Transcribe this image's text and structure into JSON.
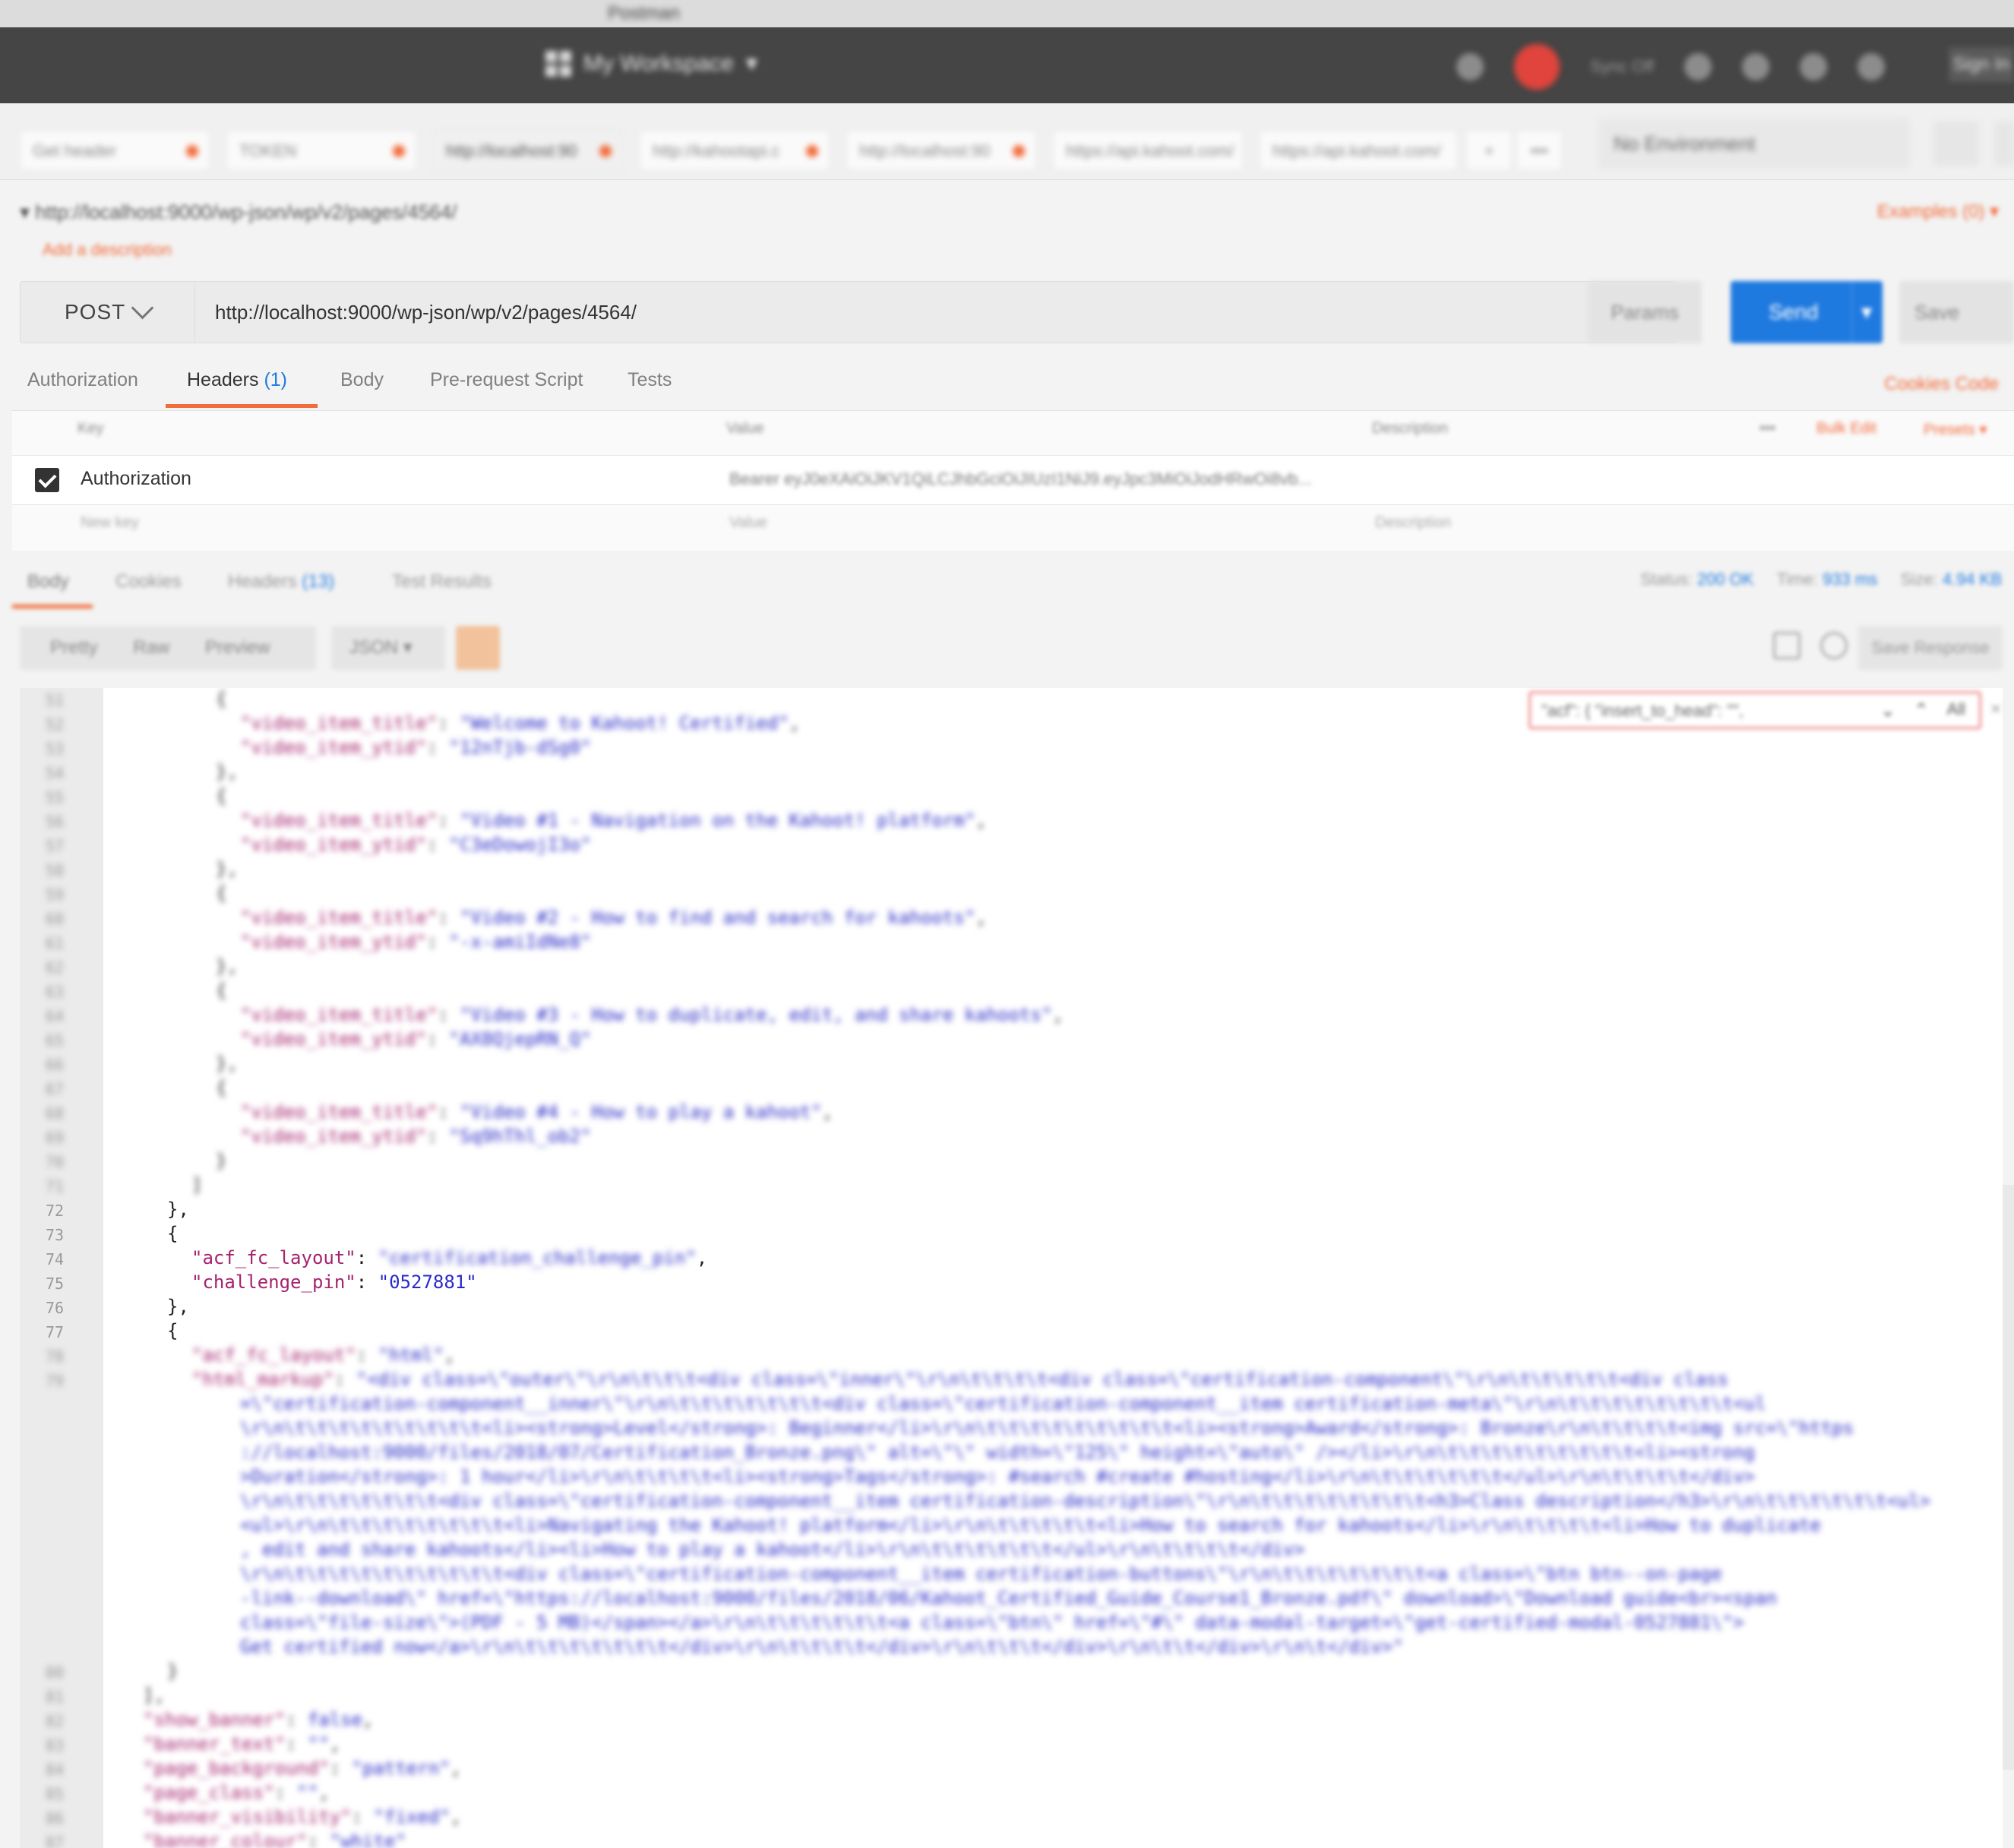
{
  "os_title": "Postman",
  "header": {
    "workspace": "My Workspace",
    "sync_status": "Sync Off",
    "sign_in": "Sign In"
  },
  "tabs": [
    {
      "label": "Get header"
    },
    {
      "label": "TOKEN"
    },
    {
      "label": "http://localhost:90"
    },
    {
      "label": "http://kahootapi.c"
    },
    {
      "label": "http://localhost:90"
    },
    {
      "label": "https://api.kahoot.com/"
    },
    {
      "label": "https://api.kahoot.com/"
    }
  ],
  "environment": "No Environment",
  "request": {
    "title_url": "http://localhost:9000/wp-json/wp/v2/pages/4564/",
    "add_description": "Add a description",
    "examples": "Examples (0)",
    "method": "POST",
    "url": "http://localhost:9000/wp-json/wp/v2/pages/4564/",
    "params": "Params",
    "send": "Send",
    "save": "Save"
  },
  "request_tabs": {
    "authorization": "Authorization",
    "headers": "Headers",
    "headers_count": "(1)",
    "body": "Body",
    "prerequest": "Pre-request Script",
    "tests": "Tests",
    "cookies": "Cookies  Code"
  },
  "headers_table": {
    "col_key": "Key",
    "col_value": "Value",
    "col_description": "Description",
    "bulk_edit": "Bulk Edit",
    "presets": "Presets",
    "row": {
      "key": "Authorization",
      "value": "Bearer eyJ0eXAiOiJKV1QiLCJhbGciOiJIUzI1NiJ9.eyJpc3MiOiJodHRwOi8vb..."
    },
    "placeholder_key": "New key",
    "placeholder_value": "Value",
    "placeholder_description": "Description"
  },
  "response": {
    "tabs": {
      "body": "Body",
      "cookies": "Cookies",
      "headers": "Headers",
      "headers_count": "(13)",
      "test_results": "Test Results"
    },
    "status_label": "Status:",
    "status": "200 OK",
    "time_label": "Time:",
    "time": "933 ms",
    "size_label": "Size:",
    "size": "4.94 KB",
    "view": {
      "pretty": "Pretty",
      "raw": "Raw",
      "preview": "Preview"
    },
    "format": "JSON",
    "save_response": "Save Response",
    "find_text": "\"acf\": {        \"insert_to_head\": \"\","
  },
  "code": {
    "line_numbers": [
      "51",
      "52",
      "53",
      "54",
      "55",
      "56",
      "57",
      "58",
      "59",
      "60",
      "61",
      "62",
      "63",
      "64",
      "65",
      "66",
      "67",
      "68",
      "69",
      "70",
      "71",
      "72",
      "73",
      "74",
      "75",
      "76",
      "77",
      "78",
      "79"
    ],
    "video_items": [
      {
        "title": "Welcome to Kahoot! Certified",
        "ytid": "12nTjb-dSg0"
      },
      {
        "title": "Video #1 - Navigation on the Kahoot! platform",
        "ytid": "C3eDowojI3o"
      },
      {
        "title": "Video #2 - How to find and search for kahoots",
        "ytid": "-x-amiIdNe8"
      },
      {
        "title": "Video #3 - How to duplicate, edit, and share kahoots",
        "ytid": "AX8QjepRN_Q"
      },
      {
        "title": "Video #4 - How to play a kahoot",
        "ytid": "Sq9hThl_ob2"
      }
    ],
    "video_title_key": "\"video_item_title\"",
    "video_ytid_key": "\"video_item_ytid\"",
    "acf_layout_key": "\"acf_fc_layout\"",
    "acf_layout_value": "\"certification_challenge_pin\"",
    "challenge_pin_key": "\"challenge_pin\"",
    "challenge_pin_value": "\"0527881\"",
    "html_layout_value": "\"html\"",
    "html_markup_key": "\"html_markup\"",
    "html_markup_lines": [
      "\"<div class=\\\"outer\\\"\\r\\n\\t\\t\\t<div class=\\\"inner\\\"\\r\\n\\t\\t\\t\\t<div class=\\\"certification-component\\\"\\r\\n\\t\\t\\t\\t\\t<div class",
      "=\\\"certification-component__inner\\\"\\r\\n\\t\\t\\t\\t\\t\\t\\t<div class=\\\"certification-component__item certification-meta\\\"\\r\\n\\t\\t\\t\\t\\t\\t\\t\\t<ul",
      "\\r\\n\\t\\t\\t\\t\\t\\t\\t\\t\\t<li><strong>Level</strong>: Beginner</li>\\r\\n\\t\\t\\t\\t\\t\\t\\t\\t\\t<li><strong>Award</strong>: Bronze\\r\\n\\t\\t\\t\\t<img src=\\\"https",
      "://localhost:9000/files/2018/07/Certification_Bronze.png\\\" alt=\\\"\\\" width=\\\"125\\\" height=\\\"auto\\\" /></li>\\r\\n\\t\\t\\t\\t\\t\\t\\t\\t\\t<li><strong",
      ">Duration</strong>: 1 hour</li>\\r\\n\\t\\t\\t\\t<li><strong>Tags</strong>: #search #create #hosting</li>\\r\\n\\t\\t\\t\\t\\t\\t</ul>\\r\\n\\t\\t\\t\\t</div>",
      "\\r\\n\\t\\t\\t\\t\\t\\t\\t<div class=\\\"certification-component__item certification-description\\\"\\r\\n\\t\\t\\t\\t\\t\\t\\t\\t<h3>Class description</h3>\\r\\n\\t\\t\\t\\t\\t\\t<ul>",
      "<ul>\\r\\n\\t\\t\\t\\t\\t\\t\\t\\t<li>Navigating the Kahoot! platform</li>\\r\\n\\t\\t\\t\\t\\t<li>How to search for kahoots</li>\\r\\n\\t\\t\\t\\t<li>How to duplicate",
      ", edit and share kahoots</li><li>How to play a kahoot</li>\\r\\n\\t\\t\\t\\t\\t\\t</ul>\\r\\n\\t\\t\\t\\t</div>",
      "\\r\\n\\t\\t\\t\\t\\t\\t\\t\\t\\t\\t<div class=\\\"certification-component__item certification-buttons\\\"\\r\\n\\t\\t\\t\\t\\t\\t\\t<a class=\\\"btn btn--on-page",
      "-link--download\\\" href=\\\"https://localhost:9000/files/2018/06/Kahoot_Certified_Guide_Course1_Bronze.pdf\\\" download>\\\"Download guide<br><span",
      "class=\\\"file-size\\\">(PDF - 5 MB)</span></a>\\r\\n\\t\\t\\t\\t\\t\\t<a class=\\\"btn\\\" href=\\\"#\\\" data-modal-target=\\\"get-certified-modal-0527881\\\">",
      "Get certified now</a>\\r\\n\\t\\t\\t\\t\\t\\t\\t</div>\\r\\n\\t\\t\\t\\t</div>\\r\\n\\t\\t\\t</div>\\r\\n\\t\\t</div>\\r\\n\\t</div>\""
    ],
    "tail_line_numbers": [
      "80",
      "81",
      "82",
      "83",
      "84",
      "85",
      "86",
      "87"
    ],
    "tail": [
      {
        "key": "\"show_banner\"",
        "value": "false",
        "comma": ","
      },
      {
        "key": "\"banner_text\"",
        "value": "\"\"",
        "comma": ","
      },
      {
        "key": "\"page_background\"",
        "value": "\"pattern\"",
        "comma": ","
      },
      {
        "key": "\"page_class\"",
        "value": "\"\"",
        "comma": ","
      },
      {
        "key": "\"banner_visibility\"",
        "value": "\"fixed\"",
        "comma": ","
      },
      {
        "key": "\"banner_colour\"",
        "value": "\"white\"",
        "comma": ""
      }
    ]
  }
}
